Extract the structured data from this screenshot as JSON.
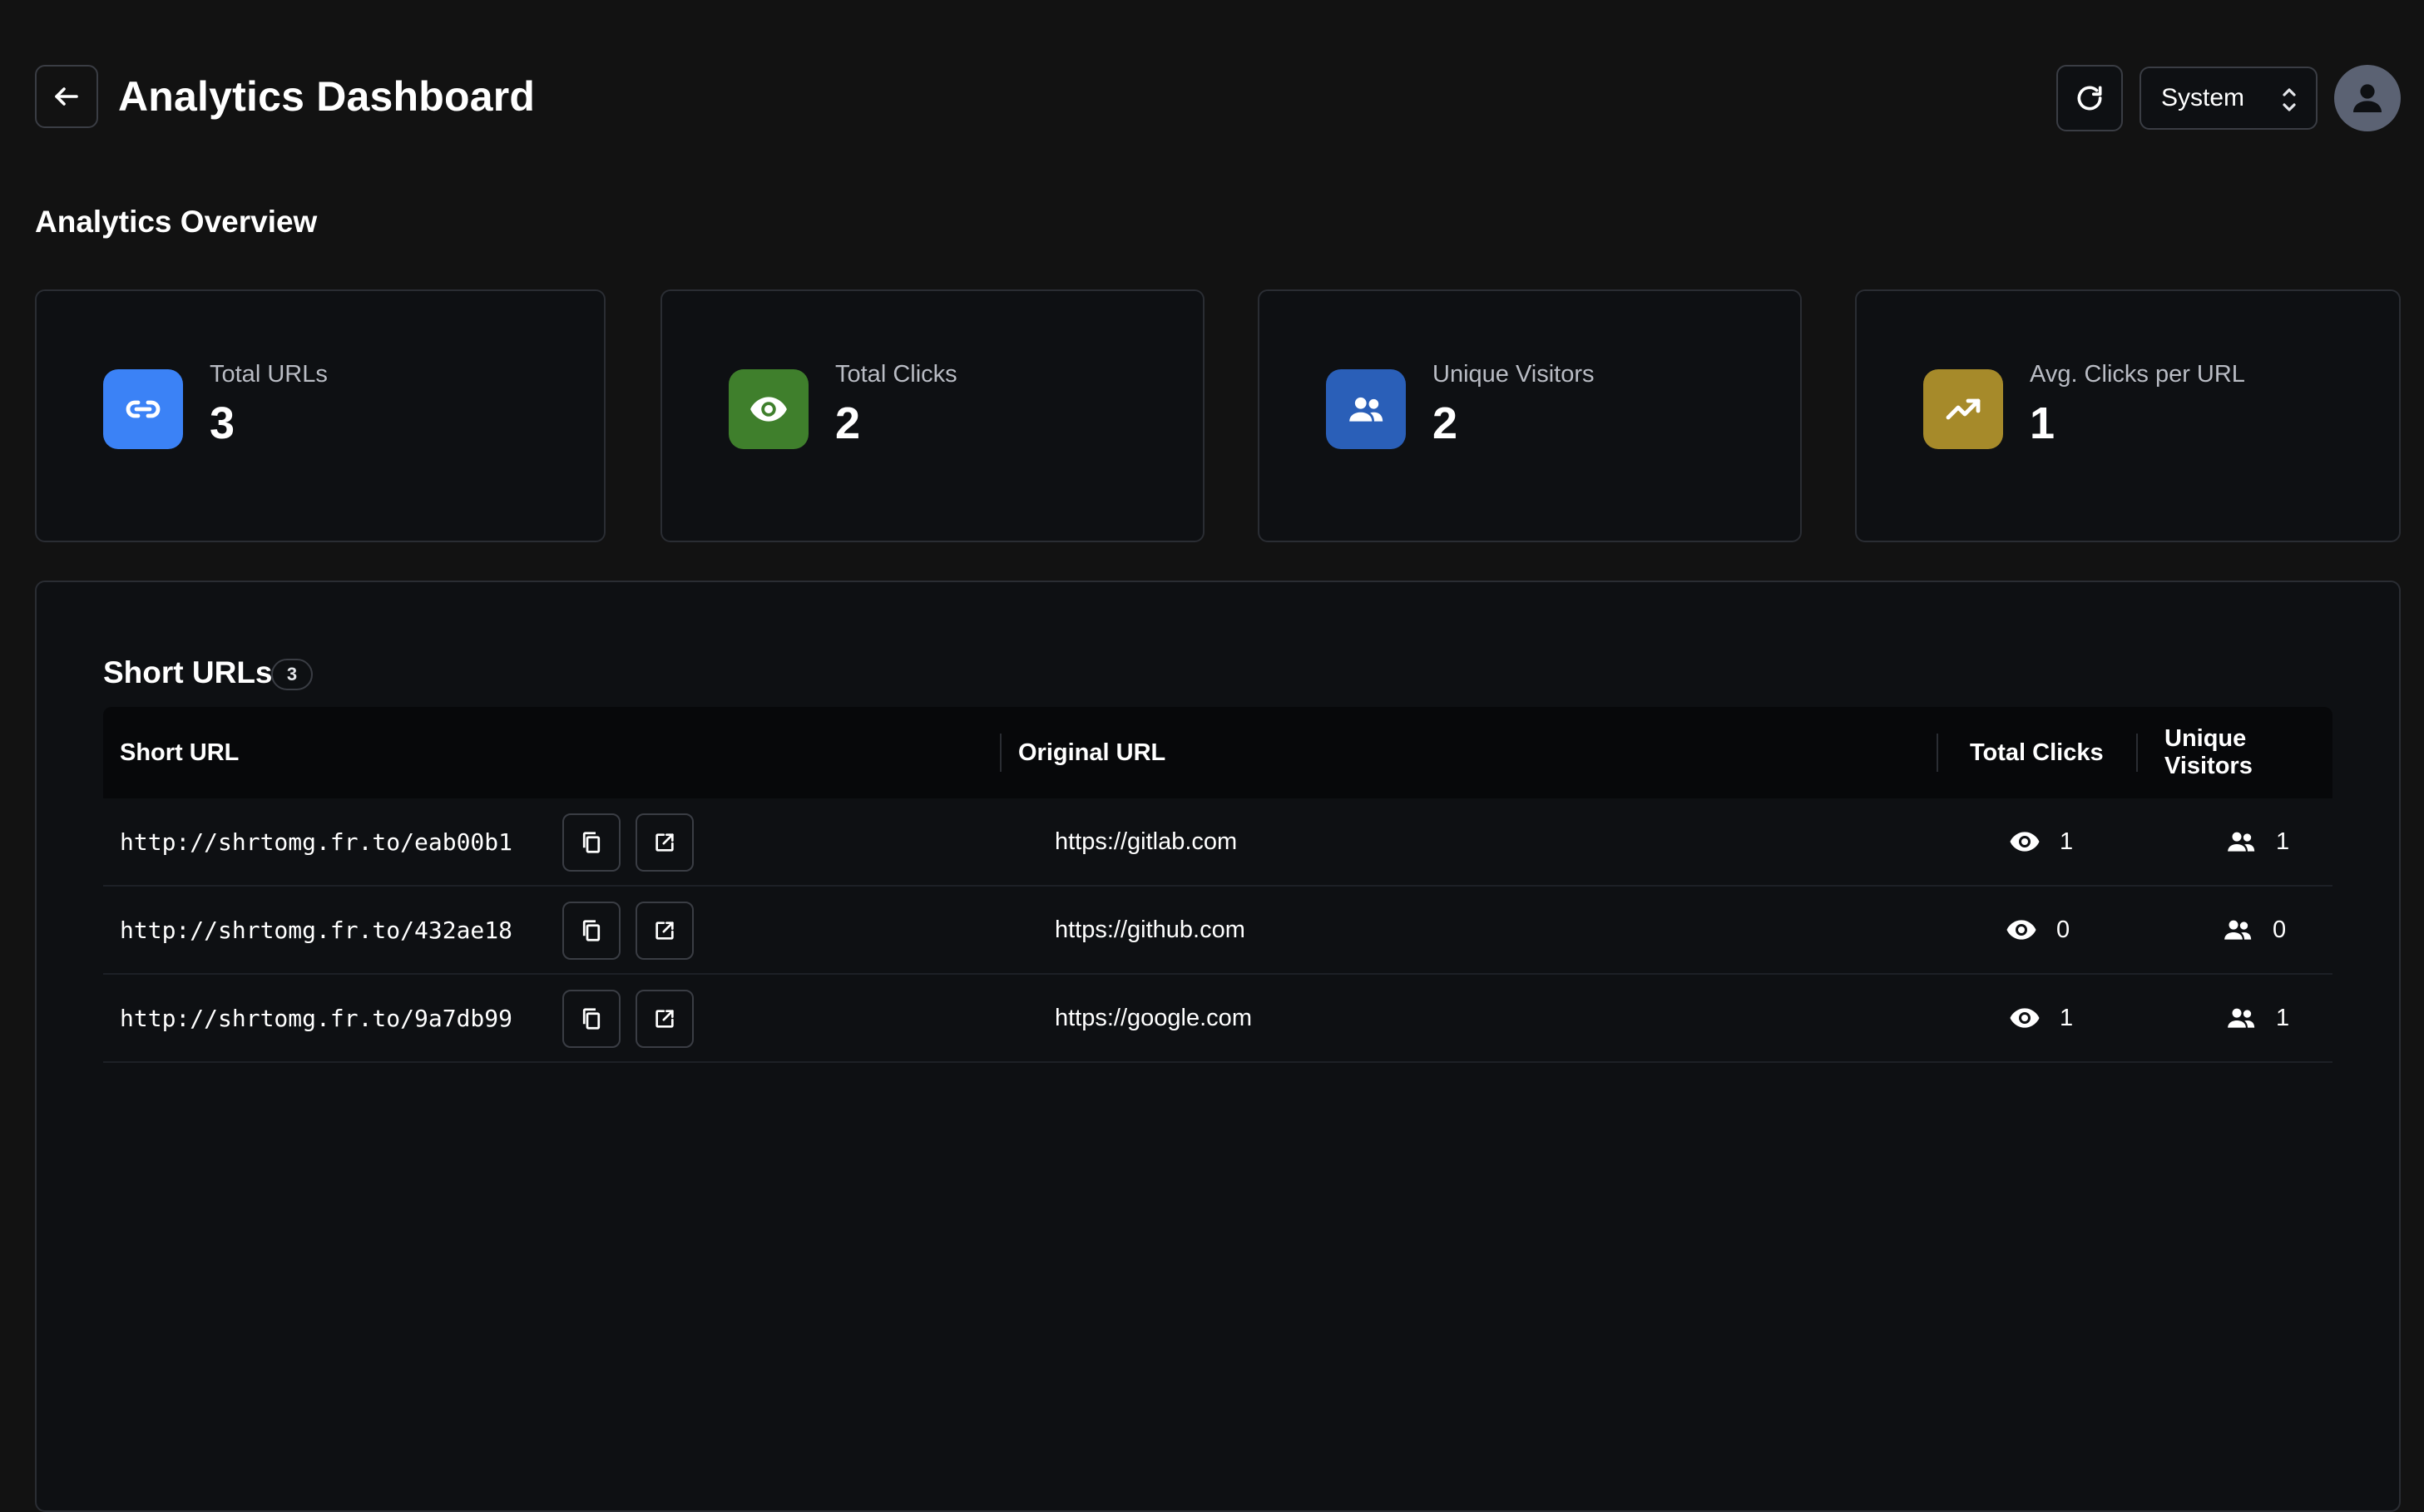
{
  "header": {
    "title": "Analytics Dashboard",
    "theme_value": "System"
  },
  "overview": {
    "title": "Analytics Overview",
    "cards": [
      {
        "label": "Total URLs",
        "value": "3",
        "icon": "link-icon",
        "color": "#3b82f6"
      },
      {
        "label": "Total Clicks",
        "value": "2",
        "icon": "eye-icon",
        "color": "#3f7f2c"
      },
      {
        "label": "Unique Visitors",
        "value": "2",
        "icon": "users-icon",
        "color": "#2a5fb8"
      },
      {
        "label": "Avg. Clicks per URL",
        "value": "1",
        "icon": "trending-up-icon",
        "color": "#a68a2a"
      }
    ]
  },
  "short_urls": {
    "title": "Short URLs",
    "count": "3",
    "columns": [
      "Short URL",
      "Original URL",
      "Total Clicks",
      "Unique Visitors"
    ],
    "rows": [
      {
        "short": "http://shrtomg.fr.to/eab00b1",
        "original": "https://gitlab.com",
        "clicks": "1",
        "visitors": "1"
      },
      {
        "short": "http://shrtomg.fr.to/432ae18",
        "original": "https://github.com",
        "clicks": "0",
        "visitors": "0"
      },
      {
        "short": "http://shrtomg.fr.to/9a7db99",
        "original": "https://google.com",
        "clicks": "1",
        "visitors": "1"
      }
    ]
  }
}
